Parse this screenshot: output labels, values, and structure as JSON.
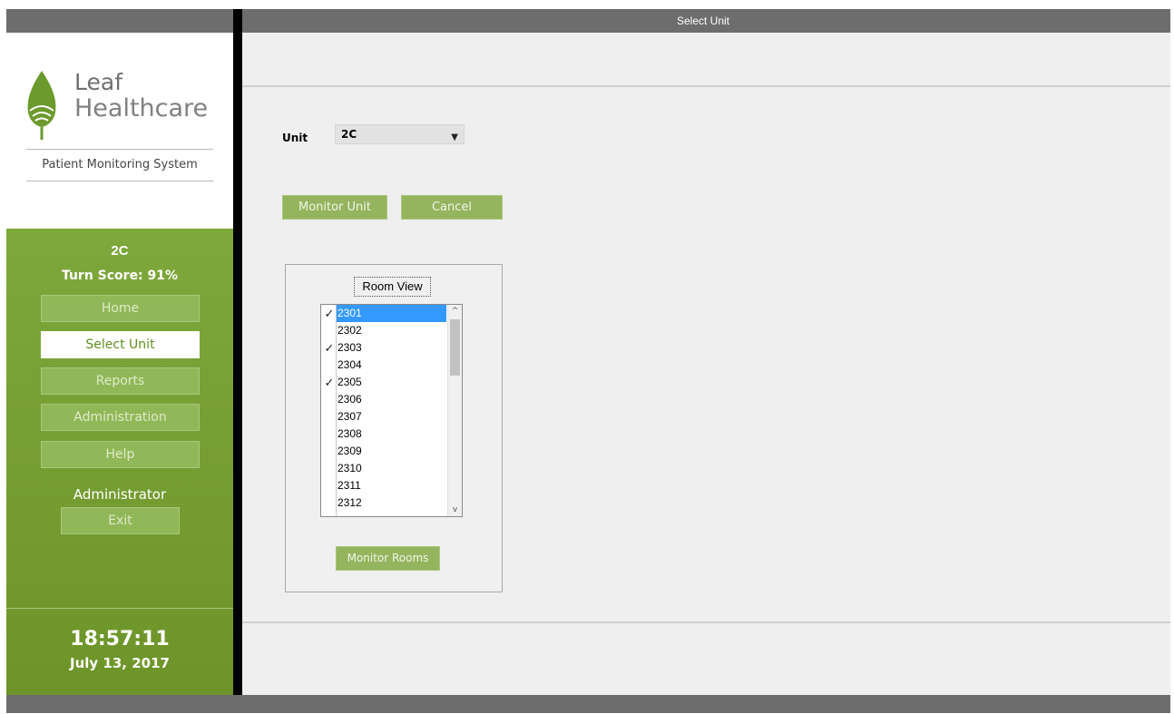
{
  "window": {
    "title": "Select Unit"
  },
  "logo": {
    "line1": "Leaf",
    "line2": "Healthcare",
    "tagline": "Patient Monitoring System"
  },
  "sidebar": {
    "unit_name": "2C",
    "turn_score": "Turn Score: 91%",
    "nav": [
      {
        "label": "Home"
      },
      {
        "label": "Select Unit"
      },
      {
        "label": "Reports"
      },
      {
        "label": "Administration"
      },
      {
        "label": "Help"
      }
    ],
    "user_label": "Administrator",
    "exit_label": "Exit",
    "clock_time": "18:57:11",
    "clock_date": "July 13, 2017"
  },
  "form": {
    "unit_label": "Unit",
    "unit_value": "2C",
    "monitor_unit_label": "Monitor Unit",
    "cancel_label": "Cancel"
  },
  "rooms": {
    "title": "Room View",
    "items": [
      {
        "label": "2301",
        "checked": true,
        "selected": true
      },
      {
        "label": "2302",
        "checked": false,
        "selected": false
      },
      {
        "label": "2303",
        "checked": true,
        "selected": false
      },
      {
        "label": "2304",
        "checked": false,
        "selected": false
      },
      {
        "label": "2305",
        "checked": true,
        "selected": false
      },
      {
        "label": "2306",
        "checked": false,
        "selected": false
      },
      {
        "label": "2307",
        "checked": false,
        "selected": false
      },
      {
        "label": "2308",
        "checked": false,
        "selected": false
      },
      {
        "label": "2309",
        "checked": false,
        "selected": false
      },
      {
        "label": "2310",
        "checked": false,
        "selected": false
      },
      {
        "label": "2311",
        "checked": false,
        "selected": false
      },
      {
        "label": "2312",
        "checked": false,
        "selected": false
      }
    ],
    "monitor_rooms_label": "Monitor Rooms"
  },
  "colors": {
    "sidebar_green": "#7ea83c",
    "button_green": "#95b45e",
    "selection_blue": "#3399ff",
    "titlebar_gray": "#6d6d6d"
  }
}
